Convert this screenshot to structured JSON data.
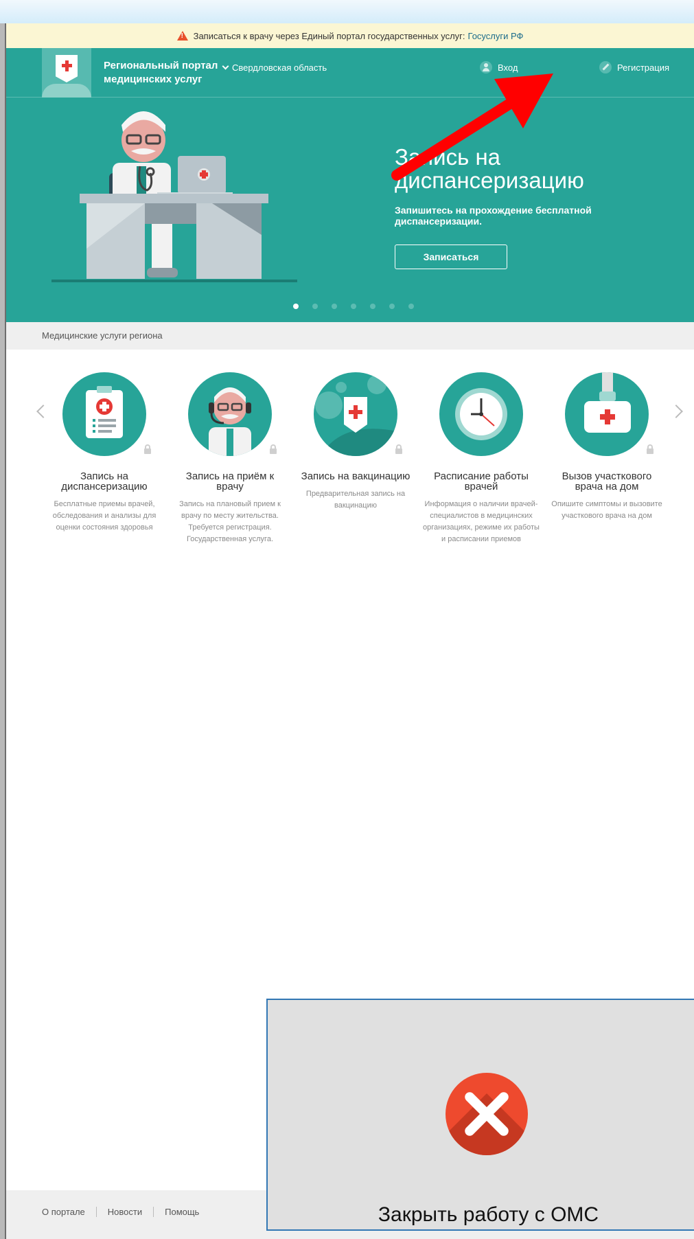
{
  "notice": {
    "text": "Записаться к врачу через Единый портал государственных услуг:",
    "link": "Госуслуги РФ"
  },
  "header": {
    "brand": "Региональный портал медицинских услуг",
    "region": "Свердловская область",
    "login": "Вход",
    "register": "Регистрация"
  },
  "banner": {
    "title": "Запись на диспансеризацию",
    "subtitle": "Запишитесь на прохождение бесплатной диспансеризации.",
    "button": "Записаться",
    "slides": 7,
    "active_slide": 1
  },
  "services_bar": "Медицинские услуги региона",
  "services": [
    {
      "title": "Запись на диспансеризацию",
      "desc": "Бесплатные приемы врачей, обследования и анализы для оценки состояния здоровья",
      "icon": "clipboard-icon"
    },
    {
      "title": "Запись на приём к врачу",
      "desc": "Запись на плановый прием к врачу по месту жительства. Требуется регистрация. Государственная услуга.",
      "icon": "doctor-headset-icon"
    },
    {
      "title": "Запись на вакцинацию",
      "desc": "Предварительная запись на вакцинацию",
      "icon": "virus-shield-icon"
    },
    {
      "title": "Расписание работы врачей",
      "desc": "Информация о наличии врачей-специалистов в медицинских организациях, режиме их работы и расписании приемов",
      "icon": "clock-icon"
    },
    {
      "title": "Вызов участкового врача на дом",
      "desc": "Опишите симптомы и вызовите участкового врача на дом",
      "icon": "medical-bag-icon"
    }
  ],
  "footer": {
    "links": [
      "О портале",
      "Новости",
      "Помощь"
    ]
  },
  "overlay": {
    "label": "Закрыть работу с ОМС"
  },
  "colors": {
    "teal": "#27a498",
    "notice_bg": "#fbf6d3",
    "close_red": "#ee4a2e",
    "arrow_red": "#ff0000"
  }
}
